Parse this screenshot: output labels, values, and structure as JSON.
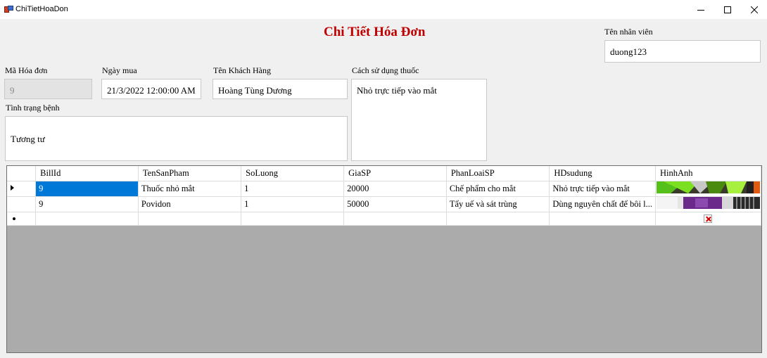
{
  "window": {
    "title": "ChiTietHoaDon",
    "controls": {
      "minimize_icon": "minimize-icon",
      "maximize_icon": "maximize-icon",
      "close_icon": "close-icon"
    }
  },
  "form": {
    "heading": "Chi Tiết Hóa Đơn",
    "heading_color": "#c00000",
    "employee": {
      "label": "Tên nhân viên",
      "value": "duong123"
    },
    "invoice_id": {
      "label": "Mã Hóa đơn",
      "value": "9"
    },
    "purchase_date": {
      "label": "Ngày mua",
      "value": "21/3/2022 12:00:00 AM"
    },
    "customer_name": {
      "label": "Tên Khách Hàng",
      "value": "Hoàng Tùng Dương"
    },
    "usage": {
      "label": "Cách sử dụng thuốc",
      "value": "Nhỏ trực tiếp vào mắt"
    },
    "condition": {
      "label": "Tình trạng bệnh",
      "value": "Tương tư"
    }
  },
  "grid": {
    "columns": [
      "BillId",
      "TenSanPham",
      "SoLuong",
      "GiaSP",
      "PhanLoaiSP",
      "HDsudung",
      "HinhAnh"
    ],
    "rows": [
      {
        "BillId": "9",
        "TenSanPham": "Thuốc nhỏ mắt",
        "SoLuong": "1",
        "GiaSP": "20000",
        "PhanLoaiSP": "Chế phẩm cho mắt",
        "HDsudung": "Nhỏ trực tiếp vào mắt",
        "selected": true,
        "current": true
      },
      {
        "BillId": "9",
        "TenSanPham": "Povidon",
        "SoLuong": "1",
        "GiaSP": "50000",
        "PhanLoaiSP": "Tẩy uế và sát trùng",
        "HDsudung": "Dùng nguyên chất để bôi l..."
      }
    ],
    "new_row_image": "broken-image-icon",
    "selection_color": "#0078d7"
  }
}
